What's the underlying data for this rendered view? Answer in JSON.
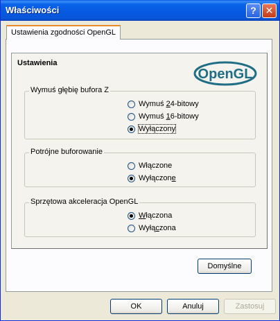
{
  "window": {
    "title": "Właściwości",
    "help_glyph": "?",
    "close_glyph": "✕"
  },
  "tab": {
    "label": "Ustawienia zgodności OpenGL"
  },
  "panel": {
    "title": "Ustawienia",
    "logo_text": "OpenGL"
  },
  "groups": {
    "zbuffer": {
      "label": "Wymuś głębię bufora Z",
      "options": [
        {
          "pre": "Wymuś ",
          "acc": "2",
          "post": "4-bitowy",
          "checked": false
        },
        {
          "pre": "Wymuś ",
          "acc": "1",
          "post": "6-bitowy",
          "checked": false
        },
        {
          "pre": "Wyłączony",
          "acc": "",
          "post": "",
          "checked": true
        }
      ]
    },
    "triple": {
      "label": "Potrójne buforowanie",
      "options": [
        {
          "pre": "Włączone",
          "acc": "",
          "post": "",
          "checked": false
        },
        {
          "pre": "Wyłączon",
          "acc": "e",
          "post": "",
          "checked": true
        }
      ]
    },
    "accel": {
      "label": "Sprzętowa akceleracja OpenGL",
      "options": [
        {
          "pre": "",
          "acc": "W",
          "post": "łączona",
          "checked": true
        },
        {
          "pre": "Wyłą",
          "acc": "c",
          "post": "zona",
          "checked": false
        }
      ]
    }
  },
  "buttons": {
    "defaults": "Domyślne",
    "ok": "OK",
    "cancel": "Anuluj",
    "apply": "Zastosuj"
  },
  "colors": {
    "title_bar": "#0558e0",
    "dialog_bg": "#ece9d8",
    "tab_accent": "#e68b2c",
    "logo": "#1f6e86"
  }
}
